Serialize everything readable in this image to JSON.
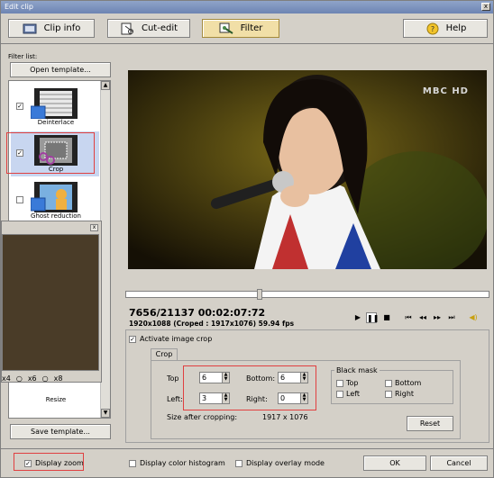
{
  "window": {
    "title": "Edit clip",
    "close_glyph": "x"
  },
  "toolbar": {
    "clip_info": "Clip info",
    "cut_edit": "Cut-edit",
    "filter": "Filter",
    "help": "Help"
  },
  "left": {
    "filter_list_label": "Filter list:",
    "open_template": "Open template...",
    "save_template": "Save template...",
    "items": [
      {
        "label": "Deinterlace",
        "checked": "✓"
      },
      {
        "label": "Crop",
        "checked": "✓"
      },
      {
        "label": "Ghost reduction",
        "checked": ""
      },
      {
        "label": "Resize",
        "checked": ""
      }
    ]
  },
  "popup": {
    "close_glyph": "x",
    "radios": [
      "x4",
      "x6",
      "x8"
    ]
  },
  "video": {
    "logo": "MBC HD"
  },
  "playback": {
    "frame": "7656/21137  00:02:07:72",
    "resolution": "1920x1088 (Croped : 1917x1076) 59.94 fps"
  },
  "crop": {
    "activate_label": "Activate image crop",
    "activate_checked": "✓",
    "tab": "Crop",
    "top_label": "Top",
    "top_value": "6",
    "bottom_label": "Bottom:",
    "bottom_value": "6",
    "left_label": "Left:",
    "left_value": "3",
    "right_label": "Right:",
    "right_value": "0",
    "size_after_label": "Size after cropping:",
    "size_after_value": "1917 x 1076",
    "black_mask_label": "Black mask",
    "mask_top": "Top",
    "mask_bottom": "Bottom",
    "mask_left": "Left",
    "mask_right": "Right",
    "reset": "Reset"
  },
  "bottom": {
    "display_zoom": "Display zoom",
    "display_zoom_checked": "✓",
    "display_histogram": "Display color histogram",
    "display_overlay": "Display overlay mode",
    "ok": "OK",
    "cancel": "Cancel"
  },
  "seek_position": 0.36,
  "colors": {
    "accent": "#f1dfa7",
    "highlight": "#e04040",
    "title": "#6d84b3"
  }
}
